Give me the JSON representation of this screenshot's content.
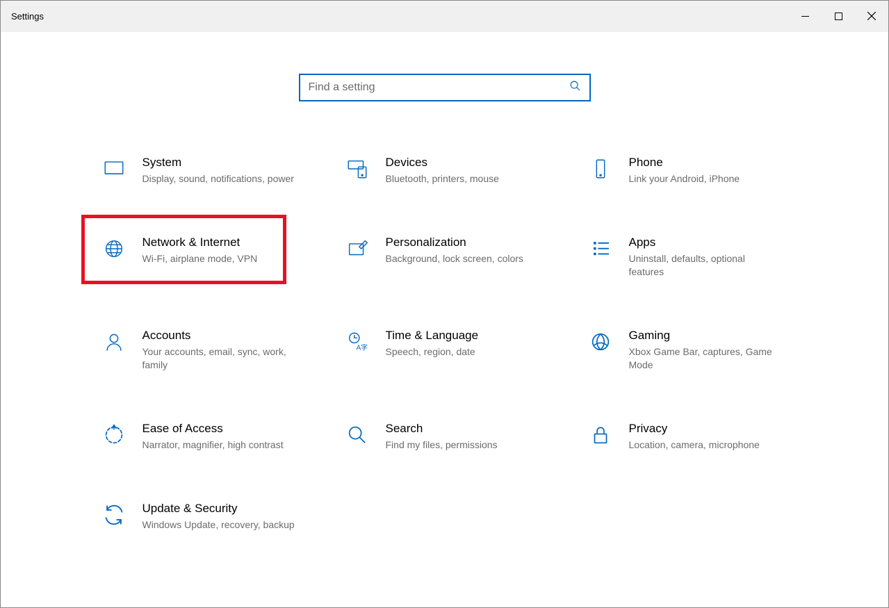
{
  "window": {
    "title": "Settings"
  },
  "search": {
    "placeholder": "Find a setting"
  },
  "tiles": {
    "system": {
      "title": "System",
      "desc": "Display, sound, notifications, power"
    },
    "devices": {
      "title": "Devices",
      "desc": "Bluetooth, printers, mouse"
    },
    "phone": {
      "title": "Phone",
      "desc": "Link your Android, iPhone"
    },
    "network": {
      "title": "Network & Internet",
      "desc": "Wi-Fi, airplane mode, VPN"
    },
    "personalization": {
      "title": "Personalization",
      "desc": "Background, lock screen, colors"
    },
    "apps": {
      "title": "Apps",
      "desc": "Uninstall, defaults, optional features"
    },
    "accounts": {
      "title": "Accounts",
      "desc": "Your accounts, email, sync, work, family"
    },
    "time": {
      "title": "Time & Language",
      "desc": "Speech, region, date"
    },
    "gaming": {
      "title": "Gaming",
      "desc": "Xbox Game Bar, captures, Game Mode"
    },
    "ease": {
      "title": "Ease of Access",
      "desc": "Narrator, magnifier, high contrast"
    },
    "searchcat": {
      "title": "Search",
      "desc": "Find my files, permissions"
    },
    "privacy": {
      "title": "Privacy",
      "desc": "Location, camera, microphone"
    },
    "update": {
      "title": "Update & Security",
      "desc": "Windows Update, recovery, backup"
    }
  }
}
